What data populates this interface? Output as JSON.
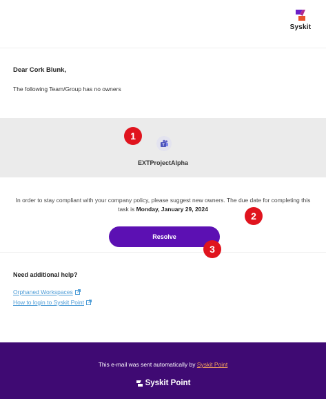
{
  "header": {
    "brand": "Syskit"
  },
  "email": {
    "greeting": "Dear Cork Blunk,",
    "message": "The following Team/Group has no owners",
    "group_name": "EXTProjectAlpha",
    "policy_text": "In order to stay compliant with your company policy, please suggest new owners. The due date for completing this task is",
    "due_date": "Monday, January 29, 2024",
    "resolve_label": "Resolve"
  },
  "help": {
    "title": "Need additional help?",
    "links": [
      {
        "label": "Orphaned Workspaces"
      },
      {
        "label": "How to login to Syskit Point"
      }
    ]
  },
  "footer": {
    "text": "This e-mail was sent automatically by",
    "link": "Syskit Point",
    "brand": "Syskit Point"
  },
  "annotations": [
    "1",
    "2",
    "3"
  ],
  "colors": {
    "primary": "#5c10b3",
    "footer_bg": "#3f0a73",
    "link": "#4b9bd6",
    "footer_link": "#f5a15b",
    "badge": "#e0141e"
  }
}
